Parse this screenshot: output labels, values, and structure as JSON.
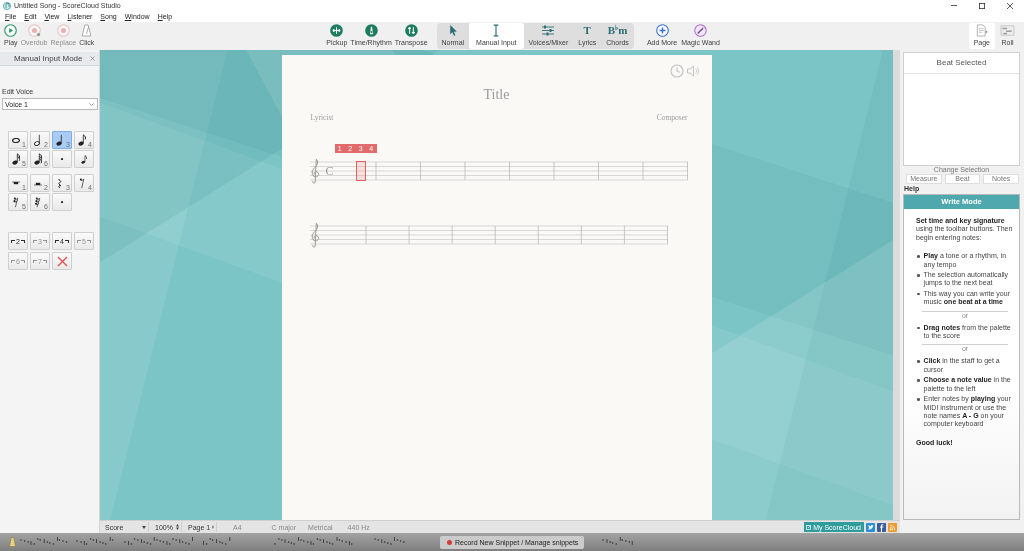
{
  "window": {
    "title": "Untitled Song - ScoreCloud Studio"
  },
  "menu": [
    "File",
    "Edit",
    "View",
    "Listener",
    "Song",
    "Window",
    "Help"
  ],
  "toolbar": {
    "transport": [
      {
        "label": "Play",
        "kind": "play",
        "disabled": false
      },
      {
        "label": "Overdub",
        "kind": "overdub",
        "disabled": true
      },
      {
        "label": "Replace",
        "kind": "replace",
        "disabled": true
      },
      {
        "label": "Click",
        "kind": "click",
        "disabled": false
      }
    ],
    "tools": [
      {
        "label": "Pickup",
        "kind": "pickup"
      },
      {
        "label": "Time/Rhythm",
        "kind": "time"
      },
      {
        "label": "Transpose",
        "kind": "transpose"
      }
    ],
    "modes": [
      {
        "label": "Normal",
        "kind": "pointer",
        "selected": false
      },
      {
        "label": "Manual Input",
        "kind": "ibeam",
        "selected": true
      },
      {
        "label": "Voices/Mixer",
        "kind": "mixer",
        "selected": false
      },
      {
        "label": "Lyrics",
        "kind": "glyph",
        "glyph": "T",
        "selected": false
      },
      {
        "label": "Chords",
        "kind": "glyph",
        "glyph": "B$^{♭}$m",
        "selected": false
      }
    ],
    "extras": [
      {
        "label": "Add More",
        "kind": "add"
      },
      {
        "label": "Magic Wand",
        "kind": "wand"
      }
    ],
    "views": [
      {
        "label": "Page",
        "kind": "page",
        "selected": true
      },
      {
        "label": "Roll",
        "kind": "roll",
        "selected": false
      }
    ]
  },
  "voice_panel": {
    "title": "Manual Input Mode",
    "edit_voice_label": "Edit Voice",
    "voice": "Voice 1",
    "notes": [
      {
        "kind": "whole",
        "key": "1",
        "selected": false
      },
      {
        "kind": "half",
        "key": "2",
        "selected": false
      },
      {
        "kind": "quarter",
        "key": "3",
        "selected": true
      },
      {
        "kind": "eighth",
        "key": "4",
        "selected": false
      },
      {
        "kind": "sixteenth",
        "key": "5",
        "selected": false
      },
      {
        "kind": "thirty-second",
        "key": "6",
        "selected": false
      },
      {
        "kind": "dot",
        "selected": false
      },
      {
        "kind": "grace",
        "selected": false
      }
    ],
    "rests": [
      {
        "kind": "whole",
        "key": "1",
        "selected": false
      },
      {
        "kind": "half",
        "key": "2",
        "selected": false
      },
      {
        "kind": "quarter",
        "key": "3",
        "selected": false
      },
      {
        "kind": "eighth",
        "key": "4",
        "selected": false
      },
      {
        "kind": "sixteenth",
        "key": "5",
        "selected": false
      },
      {
        "kind": "thirty-second",
        "key": "6",
        "selected": false
      },
      {
        "kind": "dot",
        "selected": false
      }
    ],
    "tuplets": [
      {
        "number": "2",
        "disabled": false
      },
      {
        "number": "3",
        "disabled": true
      },
      {
        "number": "4",
        "disabled": false
      },
      {
        "number": "5",
        "disabled": true
      },
      {
        "number": "6",
        "disabled": true
      },
      {
        "number": "7",
        "disabled": true
      }
    ]
  },
  "score": {
    "title": "Title",
    "lyricist": "Lyricist",
    "composer": "Composer",
    "staves": [
      {
        "time_signature": "C",
        "beat_selected": true,
        "beat_counter": [
          "1",
          "2",
          "3",
          "4"
        ]
      },
      {
        "beat_selected": false
      }
    ]
  },
  "selection_panel": {
    "title": "Beat Selected",
    "change_label": "Change Selection",
    "buttons": [
      "Measure",
      "Beat",
      "Notes"
    ]
  },
  "help": {
    "label": "Help",
    "title": "Write Mode",
    "blocks": [
      {
        "kind": "paragraph",
        "text": "**Set time and key signature** using the toolbar buttons. Then begin entering notes:"
      },
      {
        "kind": "bullets",
        "items": [
          "**Play** a tone or a rhythm, in any tempo",
          "The selection automatically jumps to the next beat",
          "This way you can write your music **one beat at a time**"
        ]
      },
      {
        "kind": "divider",
        "text": "or"
      },
      {
        "kind": "bullets",
        "items": [
          "**Drag notes** from the palette to the score"
        ]
      },
      {
        "kind": "divider",
        "text": "or"
      },
      {
        "kind": "bullets",
        "items": [
          "**Click** in the staff to get a cursor",
          "**Choose a note value** in the palette to the left",
          "Enter notes by **playing** your MIDI instrument or use the note names **A - G** on your computer keyboard"
        ]
      },
      {
        "kind": "closing",
        "text": "Good luck!"
      }
    ]
  },
  "status_bar": {
    "view": "Score",
    "zoom": "100%",
    "page": "Page 1",
    "paper": "A4",
    "key": "C major",
    "meter": "Metrical",
    "tuning": "440 Hz",
    "account": "My ScoreCloud"
  },
  "snippet_bar": {
    "button": "Record New Snippet / Manage snippets"
  }
}
